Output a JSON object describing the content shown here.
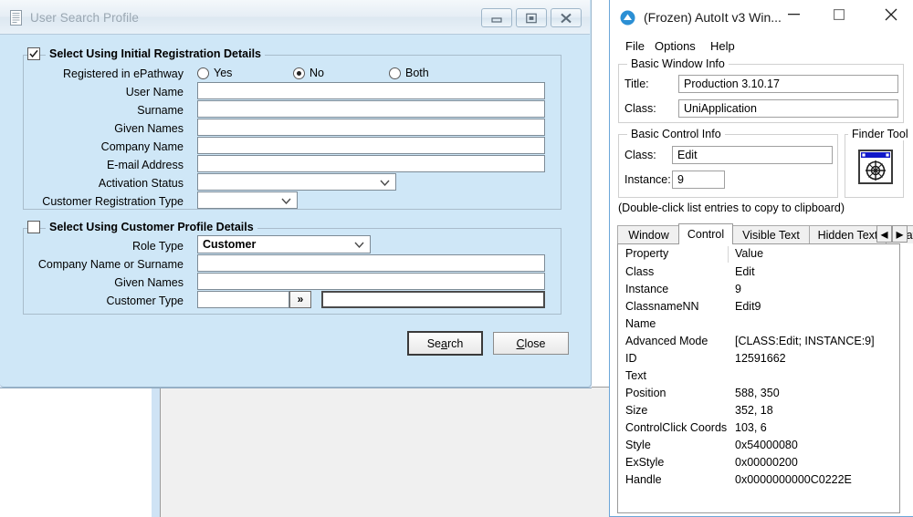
{
  "window1": {
    "title": "User Search Profile",
    "icon": "document-icon",
    "titlebar_buttons": [
      {
        "name": "minimize",
        "glyph": "minimize-icon"
      },
      {
        "name": "restore",
        "glyph": "restore-icon"
      },
      {
        "name": "close",
        "glyph": "close-icon"
      }
    ],
    "group1": {
      "legend": "Select Using Initial Registration Details",
      "checked": true,
      "radio_row": {
        "label": "Registered in ePathway",
        "options": [
          "Yes",
          "No",
          "Both"
        ],
        "selected": "No"
      },
      "fields": [
        {
          "label": "User Name",
          "value": "",
          "type": "text"
        },
        {
          "label": "Surname",
          "value": "",
          "type": "text"
        },
        {
          "label": "Given Names",
          "value": "",
          "type": "text"
        },
        {
          "label": "Company Name",
          "value": "",
          "type": "text"
        },
        {
          "label": "E-mail Address",
          "value": "",
          "type": "text"
        },
        {
          "label": "Activation Status",
          "value": "",
          "type": "combo"
        },
        {
          "label": "Customer Registration Type",
          "value": "",
          "type": "combo"
        }
      ]
    },
    "group2": {
      "legend": "Select Using Customer Profile Details",
      "checked": false,
      "role_type": {
        "label": "Role Type",
        "value": "Customer"
      },
      "fields": [
        {
          "label": "Company Name or Surname",
          "value": ""
        },
        {
          "label": "Given Names",
          "value": ""
        }
      ],
      "customer_type": {
        "label": "Customer Type",
        "code_value": "",
        "lookup_button": "»",
        "desc_value": ""
      }
    },
    "buttons": {
      "search": {
        "pre": "Se",
        "accel": "a",
        "post": "rch",
        "default": true
      },
      "close": {
        "pre": "",
        "accel": "C",
        "post": "lose",
        "default": false
      }
    }
  },
  "window2": {
    "title": "(Frozen) AutoIt v3 Win...",
    "logo": "autoit-logo-icon",
    "controls": [
      {
        "name": "minimize",
        "glyph": "—"
      },
      {
        "name": "maximize",
        "glyph": "□"
      },
      {
        "name": "close",
        "glyph": "✕"
      }
    ],
    "menu": [
      "File",
      "Options",
      "Help"
    ],
    "basic_window_info": {
      "legend": "Basic Window Info",
      "rows": [
        {
          "label": "Title:",
          "value": "Production 3.10.17"
        },
        {
          "label": "Class:",
          "value": "UniApplication"
        }
      ]
    },
    "basic_control_info": {
      "legend": "Basic Control Info",
      "rows": [
        {
          "label": "Class:",
          "value": "Edit"
        },
        {
          "label": "Instance:",
          "value": "9"
        }
      ]
    },
    "finder_tool": {
      "legend": "Finder Tool",
      "icon": "finder-crosshair-icon"
    },
    "hint": "(Double-click list entries to copy to clipboard)",
    "tabs": [
      {
        "label": "Window",
        "active": false
      },
      {
        "label": "Control",
        "active": true
      },
      {
        "label": "Visible Text",
        "active": false
      },
      {
        "label": "Hidden Text",
        "active": false
      },
      {
        "label": "Stat",
        "active": false
      }
    ],
    "tab_spinners": [
      "◂",
      "▸"
    ],
    "listview": {
      "columns": [
        "Property",
        "Value"
      ],
      "rows": [
        {
          "property": "Class",
          "value": "Edit"
        },
        {
          "property": "Instance",
          "value": "9"
        },
        {
          "property": "ClassnameNN",
          "value": "Edit9"
        },
        {
          "property": "Name",
          "value": ""
        },
        {
          "property": "Advanced Mode",
          "value": "[CLASS:Edit; INSTANCE:9]"
        },
        {
          "property": "ID",
          "value": "12591662"
        },
        {
          "property": "Text",
          "value": ""
        },
        {
          "property": "Position",
          "value": "588, 350"
        },
        {
          "property": "Size",
          "value": "352, 18"
        },
        {
          "property": "ControlClick Coords",
          "value": "103, 6"
        },
        {
          "property": "Style",
          "value": "0x54000080"
        },
        {
          "property": "ExStyle",
          "value": "0x00000200"
        },
        {
          "property": "Handle",
          "value": "0x0000000000C0222E"
        }
      ]
    }
  },
  "colors": {
    "dialog_background": "#cfe7f7",
    "window2_background": "#ffffff",
    "window2_border": "#6ca6d8",
    "titlebar_text": "#9aa7b2",
    "groupbox_border": "#a9bccb"
  }
}
